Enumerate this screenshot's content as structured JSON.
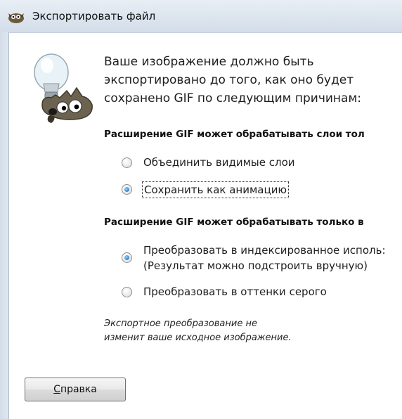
{
  "window": {
    "title": "Экспортировать файл",
    "icon": "gimp-icon"
  },
  "dialog": {
    "intro": "Ваше изображение должно быть\nэкспортировано до того, как оно будет\nсохранено GIF по следующим причинам:",
    "section_layers": {
      "heading": "Расширение GIF может обрабатывать слои тол",
      "options": [
        {
          "label": "Объединить видимые слои",
          "checked": false
        },
        {
          "label": "Сохранить как анимацию",
          "checked": true,
          "focused": true
        }
      ]
    },
    "section_color": {
      "heading": "Расширение GIF может обрабатывать только в",
      "options": [
        {
          "label": "Преобразовать в индексированное исполь:\n(Результат можно подстроить вручную)",
          "checked": true
        },
        {
          "label": "Преобразовать в оттенки серого",
          "checked": false
        }
      ]
    },
    "note": "Экспортное преобразование не\nизменит ваше исходное изображение.",
    "help_button": {
      "accel": "С",
      "rest": "правка"
    }
  },
  "icons": [
    "gimp-icon",
    "gimp-hint-mascot-icon",
    "radio-icon"
  ]
}
